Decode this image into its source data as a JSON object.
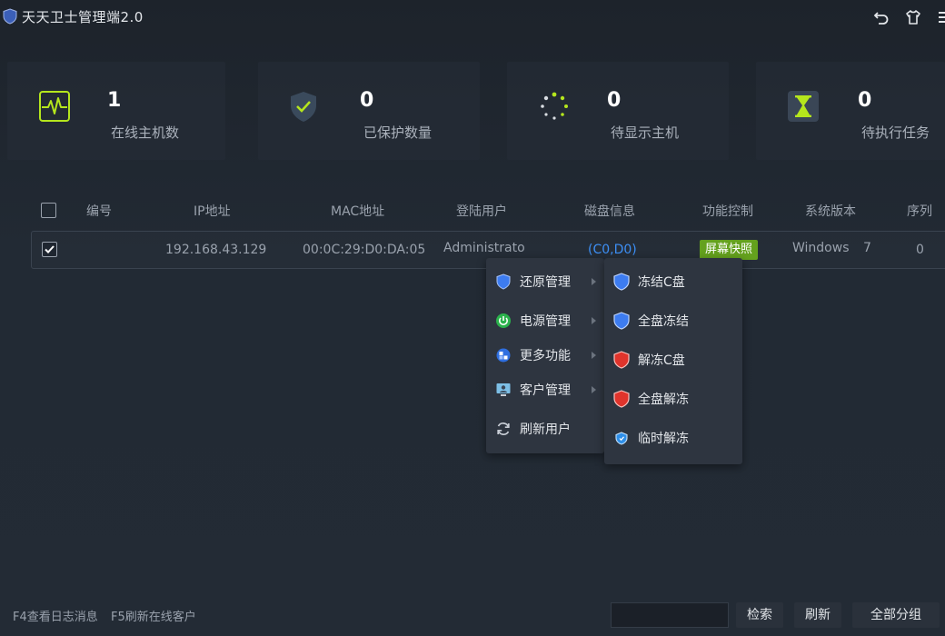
{
  "app": {
    "title": "天天卫士管理端2.0"
  },
  "titlebar": {
    "back_icon": "undo-icon",
    "skin_icon": "tshirt-icon",
    "menu_icon": "hamburger-icon"
  },
  "stats": [
    {
      "value": "1",
      "label": "在线主机数",
      "icon": "pulse-icon"
    },
    {
      "value": "0",
      "label": "已保护数量",
      "icon": "shield-check-icon"
    },
    {
      "value": "0",
      "label": "待显示主机",
      "icon": "spinner-icon"
    },
    {
      "value": "0",
      "label": "待执行任务",
      "icon": "hourglass-icon"
    }
  ],
  "table": {
    "columns": [
      "编号",
      "IP地址",
      "MAC地址",
      "登陆用户",
      "磁盘信息",
      "功能控制",
      "系统版本",
      "序列"
    ],
    "rows": [
      {
        "checked": true,
        "id": "",
        "ip": "192.168.43.129",
        "mac": "00:0C:29:D0:DA:05",
        "user": "Administrato",
        "disk": "(C0,D0)",
        "control": "屏幕快照",
        "os": "Windows",
        "os_ver": "7",
        "seq": "0"
      }
    ]
  },
  "context_menu": {
    "items": [
      {
        "label": "还原管理",
        "icon": "shield-icon",
        "has_submenu": true
      },
      {
        "label": "电源管理",
        "icon": "power-icon",
        "has_submenu": true
      },
      {
        "label": "更多功能",
        "icon": "more-functions-icon",
        "has_submenu": true
      },
      {
        "label": "客户管理",
        "icon": "client-icon",
        "has_submenu": true
      },
      {
        "label": "刷新用户",
        "icon": "refresh-icon",
        "has_submenu": false
      }
    ]
  },
  "submenu": {
    "items": [
      {
        "label": "冻结C盘",
        "icon": "blue-shield-icon"
      },
      {
        "label": "全盘冻结",
        "icon": "blue-shield-icon"
      },
      {
        "label": "解冻C盘",
        "icon": "red-shield-icon"
      },
      {
        "label": "全盘解冻",
        "icon": "red-shield-icon"
      },
      {
        "label": "临时解冻",
        "icon": "small-shield-icon"
      }
    ]
  },
  "footer": {
    "hint_f4": "F4查看日志消息",
    "hint_f5": "F5刷新在线客户",
    "search_value": "",
    "search_label": "检索",
    "refresh_label": "刷新",
    "group_label": "全部分组"
  },
  "colors": {
    "accent_green": "#64a11d",
    "disk_blue": "#3d8ff5",
    "icon_lime": "#b5e61d"
  }
}
